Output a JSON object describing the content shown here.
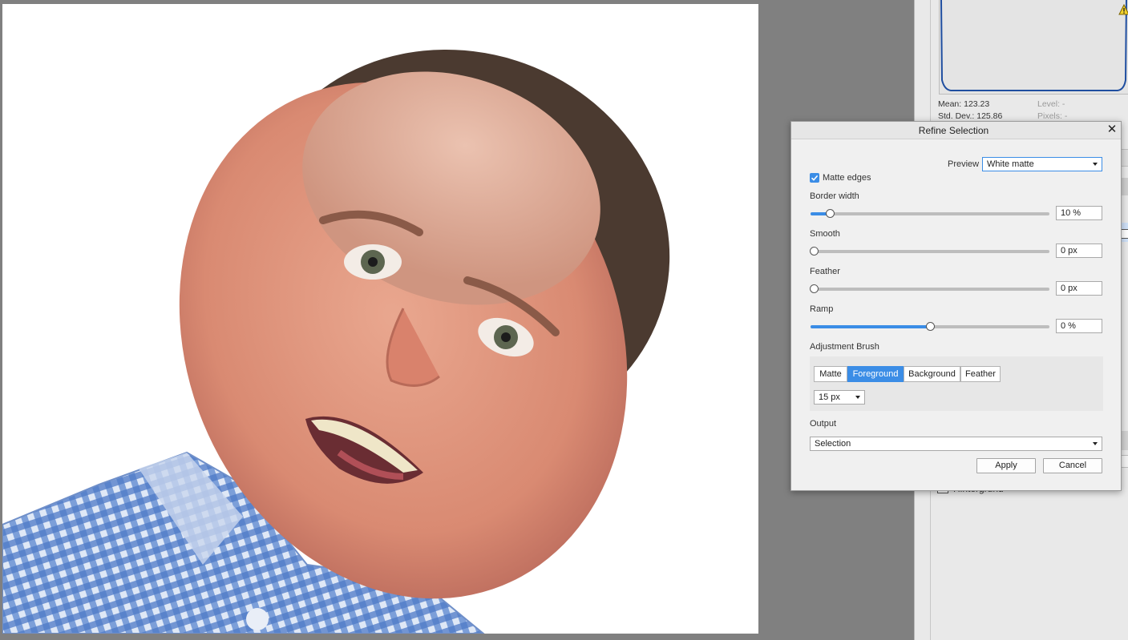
{
  "histogram": {
    "mean": "Mean: 123.23",
    "std_dev": "Std. Dev.: 125.86",
    "level": "Level: -",
    "pixels": "Pixels: -",
    "series_color": "#1f4ea0"
  },
  "layers": {
    "background_label": "Hintergrund"
  },
  "dialog": {
    "title": "Refine Selection",
    "close_glyph": "✕",
    "preview_label": "Preview",
    "preview_value": "White matte",
    "matte_edges_label": "Matte edges",
    "matte_edges_checked": true,
    "border_width": {
      "label": "Border width",
      "value": "10 %",
      "level": 0.08
    },
    "smooth": {
      "label": "Smooth",
      "value": "0 px",
      "level": 0.0
    },
    "feather": {
      "label": "Feather",
      "value": "0 px",
      "level": 0.0
    },
    "ramp": {
      "label": "Ramp",
      "value": "0 %",
      "level": 0.5
    },
    "adjustment_brush_label": "Adjustment Brush",
    "brush_modes": [
      "Matte",
      "Foreground",
      "Background",
      "Feather"
    ],
    "active_brush_mode": "Foreground",
    "brush_size": "15 px",
    "output_label": "Output",
    "output_value": "Selection",
    "apply_label": "Apply",
    "cancel_label": "Cancel",
    "accent_color": "#3b8de6"
  }
}
